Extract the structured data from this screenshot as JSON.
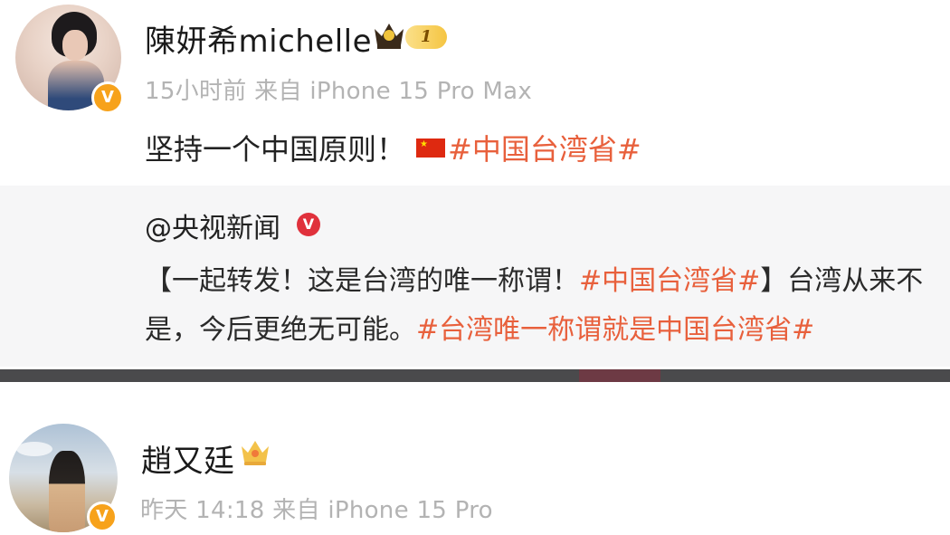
{
  "post1": {
    "username": "陳妍希michelle",
    "level_label": "1",
    "verify_label": "V",
    "meta": "15小时前 来自 iPhone 15 Pro Max",
    "text": "坚持一个中国原则！",
    "hashtag": "#中国台湾省#"
  },
  "repost": {
    "author": "@央视新闻",
    "vip_label": "V",
    "line1_text": "【一起转发！这是台湾的唯一称谓！",
    "line1_hashtag": "#中国台湾省#",
    "line1_tail": "】台湾从来不",
    "line2_text": "是，今后更绝无可能。",
    "line2_hashtag": "#台湾唯一称谓就是中国台湾省#"
  },
  "post2": {
    "username": "趙又廷",
    "verify_label": "V",
    "meta": "昨天 14:18 来自 iPhone 15 Pro"
  },
  "colors": {
    "hashtag": "#e8603c",
    "verify_orange": "#f7a21b",
    "vip_red": "#e0313c",
    "meta_gray": "#b3b3b3"
  },
  "icons": [
    "crown-icon",
    "china-flag-icon",
    "verified-badge-icon",
    "vip-badge-icon"
  ]
}
